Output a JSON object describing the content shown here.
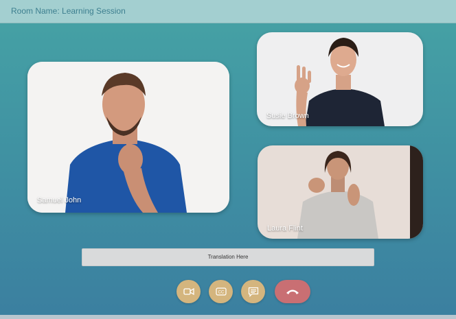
{
  "room": {
    "title": "Room Name: Learning Session"
  },
  "participants": [
    {
      "name": "Samuel John"
    },
    {
      "name": "Susie Brown"
    },
    {
      "name": "Laura Flint"
    }
  ],
  "translation": {
    "text": "Translation Here"
  },
  "controls": {
    "video_icon": "video-camera-icon",
    "cc_icon": "closed-captions-icon",
    "chat_icon": "chat-message-icon",
    "end_icon": "phone-hangup-icon"
  },
  "colors": {
    "background_top": "#46a3a5",
    "background_bottom": "#3b7fa0",
    "topbar": "#a3cfd0",
    "control_button": "#d4b57e",
    "end_call_button": "#c96f73"
  }
}
